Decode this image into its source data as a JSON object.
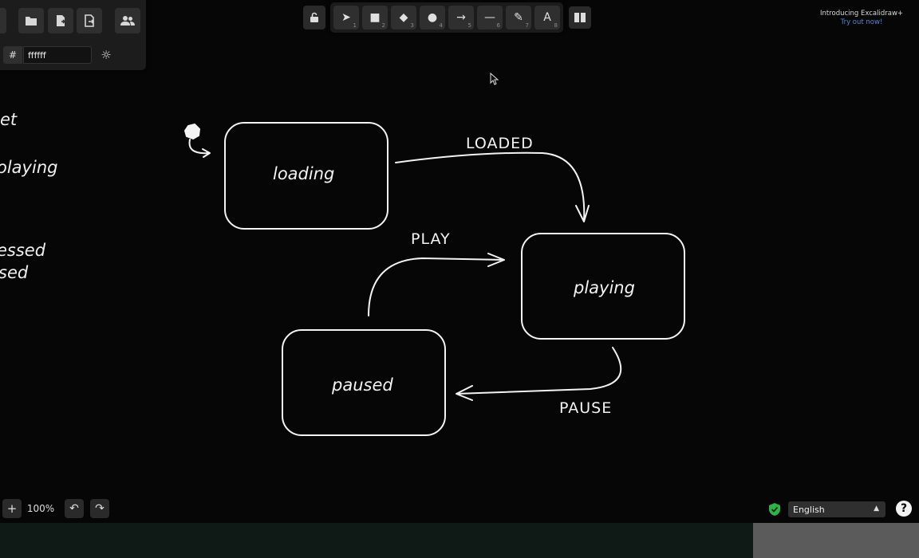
{
  "menu": {
    "buttons": [
      {
        "name": "open",
        "icon": "folder-open-icon",
        "glyph": "▰"
      },
      {
        "name": "save",
        "icon": "save-file-icon",
        "glyph": "▤"
      },
      {
        "name": "export",
        "icon": "export-image-icon",
        "glyph": "⇲"
      },
      {
        "name": "collaborate",
        "icon": "users-icon",
        "glyph": "👥"
      }
    ],
    "background_hash": "#",
    "background_value": "ffffff",
    "theme_icon": "sun-icon"
  },
  "toolbar": {
    "lock_icon": "lock-icon",
    "tools": [
      {
        "name": "selection",
        "icon": "pointer-icon",
        "glyph": "➤",
        "key": "1"
      },
      {
        "name": "rectangle",
        "icon": "square-icon",
        "glyph": "■",
        "key": "2"
      },
      {
        "name": "diamond",
        "icon": "diamond-icon",
        "glyph": "◆",
        "key": "3"
      },
      {
        "name": "ellipse",
        "icon": "circle-icon",
        "glyph": "●",
        "key": "4"
      },
      {
        "name": "arrow",
        "icon": "arrow-icon",
        "glyph": "→",
        "key": "5"
      },
      {
        "name": "line",
        "icon": "line-icon",
        "glyph": "—",
        "key": "6"
      },
      {
        "name": "draw",
        "icon": "pencil-icon",
        "glyph": "✎",
        "key": "7"
      },
      {
        "name": "text",
        "icon": "text-icon",
        "glyph": "A",
        "key": "8"
      }
    ],
    "library_icon": "library-book-icon"
  },
  "promo": {
    "line1": "Introducing Excalidraw+",
    "line2": "Try out now!"
  },
  "diagram": {
    "states": [
      "loading",
      "playing",
      "paused"
    ],
    "transitions": [
      "LOADED",
      "PLAY",
      "PAUSE"
    ]
  },
  "left_fragments": [
    "et",
    "olaying",
    "essed",
    "sed"
  ],
  "footer": {
    "zoom_in": "+",
    "zoom_level": "100%",
    "undo": "↶",
    "redo": "↷",
    "language": "English",
    "help": "?"
  },
  "colors": {
    "canvas": "#060606",
    "stroke": "#f3f3f3",
    "accent_link": "#4f86d6",
    "shield": "#2fb344"
  }
}
